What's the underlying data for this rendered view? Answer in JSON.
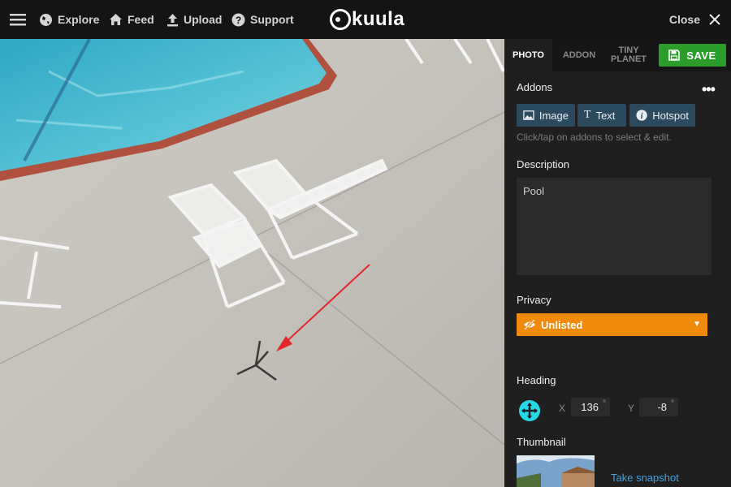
{
  "nav": {
    "explore": "Explore",
    "feed": "Feed",
    "upload": "Upload",
    "support": "Support",
    "logo": "kuula",
    "close": "Close"
  },
  "tabs": {
    "photo": "PHOTO",
    "addon": "ADDON",
    "tiny_planet_line1": "TINY",
    "tiny_planet_line2": "PLANET",
    "save": "SAVE"
  },
  "addons": {
    "title": "Addons",
    "more": "•••",
    "image": "Image",
    "text": "Text",
    "hotspot": "Hotspot",
    "hint": "Click/tap on addons to select & edit."
  },
  "description": {
    "title": "Description",
    "value": "Pool"
  },
  "privacy": {
    "title": "Privacy",
    "value": "Unlisted",
    "caret": "▼"
  },
  "heading": {
    "title": "Heading",
    "x_label": "X",
    "x_value": "136",
    "y_label": "Y",
    "y_value": "-8",
    "degree": "°"
  },
  "thumbnail": {
    "title": "Thumbnail",
    "snapshot": "Take snapshot"
  },
  "colors": {
    "save": "#2a9d2a",
    "privacy": "#f08a0c",
    "addon_button": "#2b4a5e",
    "heading_icon": "#28d7e6",
    "link": "#3fa2e0"
  },
  "icons": [
    "menu-icon",
    "globe-icon",
    "home-icon",
    "upload-icon",
    "help-icon",
    "close-icon",
    "floppy-icon",
    "image-icon",
    "text-icon",
    "info-icon",
    "eye-slash-icon",
    "crosshair-icon"
  ]
}
